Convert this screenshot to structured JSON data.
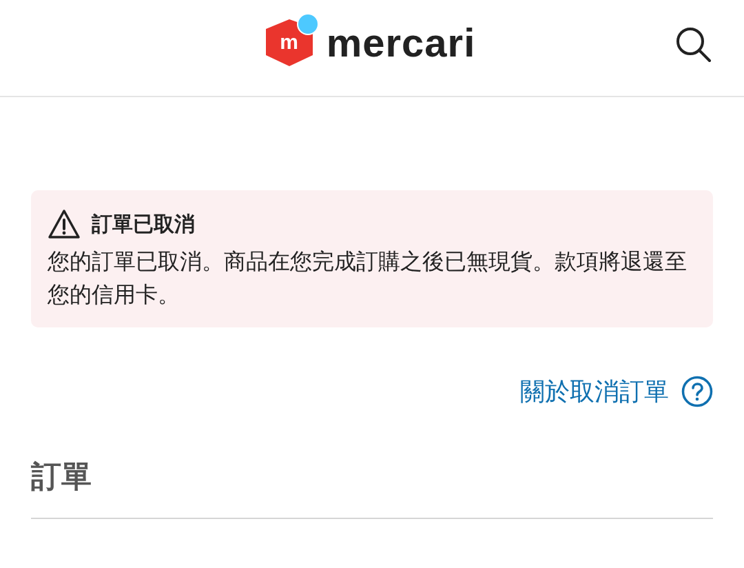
{
  "header": {
    "logo": {
      "mark": "m",
      "wordmark": "mercari"
    }
  },
  "alert": {
    "title": "訂單已取消",
    "message": "您的訂單已取消。商品在您完成訂購之後已無現貨。款項將退還至您的信用卡。"
  },
  "help_link": {
    "label": "關於取消訂單"
  },
  "section": {
    "title": "訂單"
  }
}
